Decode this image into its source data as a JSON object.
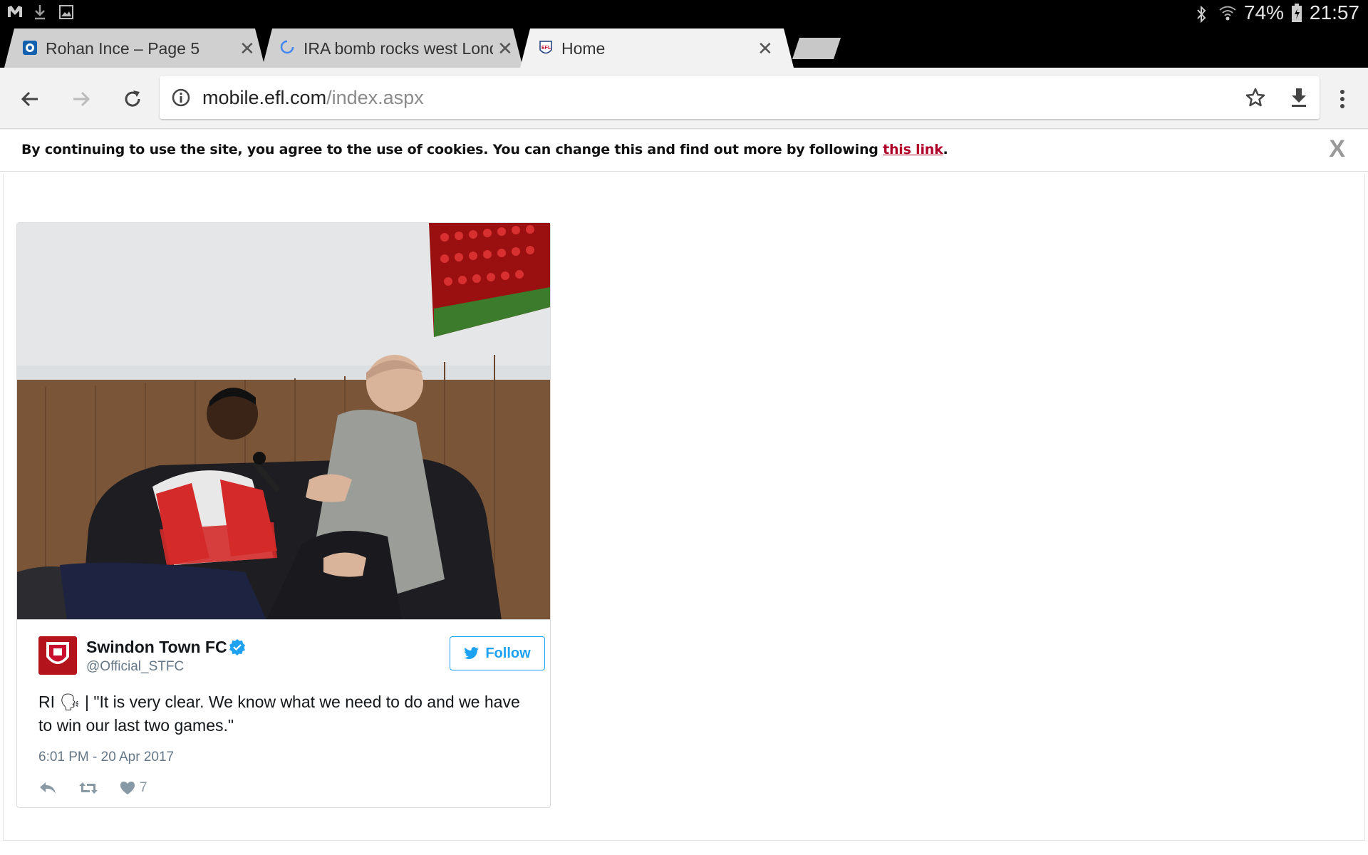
{
  "status_bar": {
    "battery": "74%",
    "time": "21:57",
    "left_icons": [
      "mail-app-icon",
      "download-icon",
      "image-icon"
    ],
    "right_icons": [
      "bluetooth-icon",
      "wifi-icon",
      "battery-icon"
    ]
  },
  "tabs": [
    {
      "title": "Rohan Ince – Page 5",
      "active": false
    },
    {
      "title": "IRA bomb rocks west London",
      "active": false
    },
    {
      "title": "Home",
      "active": true
    }
  ],
  "toolbar": {
    "url_host": "mobile.efl.com",
    "url_path": "/index.aspx"
  },
  "cookie_banner": {
    "text": "By continuing to use the site, you agree to the use of cookies. You can change this and find out more by following ",
    "link_text": "this link",
    "suffix": ".",
    "close_label": "X"
  },
  "tweet": {
    "account_name": "Swindon Town FC",
    "handle": "@Official_STFC",
    "follow_label": "Follow",
    "text": "RI 🗣 | \"It is very clear. We know what we need to do and we have to win our last two games.\"",
    "timestamp": "6:01 PM - 20 Apr 2017",
    "likes": "7"
  },
  "colors": {
    "twitter_blue": "#1da1f2",
    "cookie_link": "#b0002a",
    "stfc_red": "#b3131a"
  }
}
